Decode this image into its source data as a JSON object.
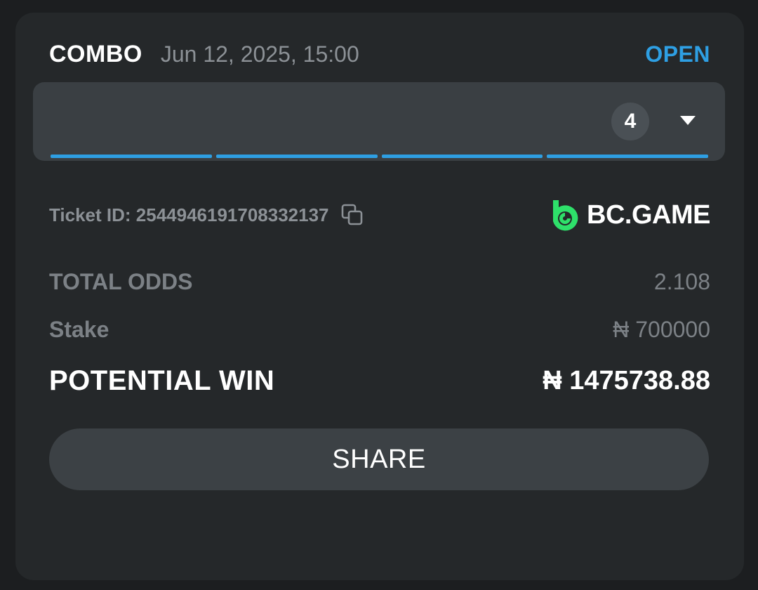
{
  "bet": {
    "type": "COMBO",
    "date": "Jun 12, 2025, 15:00",
    "status": "OPEN"
  },
  "legs": {
    "count": "4",
    "progress_segments": 4
  },
  "ticket": {
    "label": "Ticket ID: 2544946191708332137"
  },
  "brand": {
    "name": "BC.GAME",
    "logo_color": "#2ee06a"
  },
  "summary": {
    "total_odds_label": "TOTAL ODDS",
    "total_odds_value": "2.108",
    "stake_label": "Stake",
    "stake_value": "₦ 700000",
    "potential_win_label": "POTENTIAL WIN",
    "potential_win_value": "₦ 1475738.88"
  },
  "actions": {
    "share_label": "SHARE"
  },
  "colors": {
    "accent": "#2e9fe3",
    "card_bg": "#25282a",
    "muted": "#8c9196"
  }
}
